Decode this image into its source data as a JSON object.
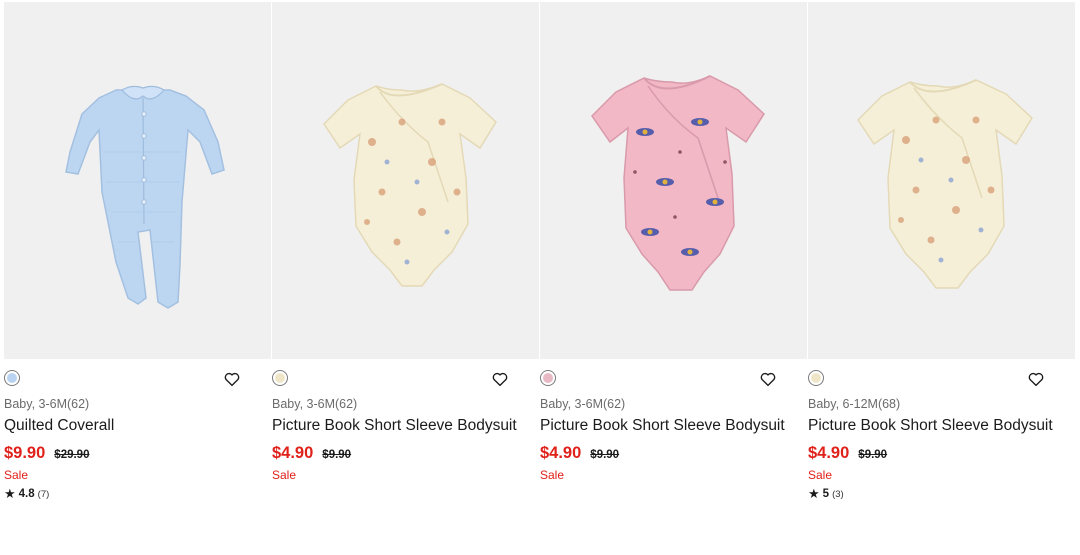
{
  "products": [
    {
      "size": "Baby, 3-6M(62)",
      "name": "Quilted Coverall",
      "price": "$9.90",
      "original_price": "$29.90",
      "sale_label": "Sale",
      "rating": "4.8",
      "review_count": "(7)",
      "color": "#b9d3f0",
      "image_icon": "blue-coverall-image"
    },
    {
      "size": "Baby, 3-6M(62)",
      "name": "Picture Book Short Sleeve Bodysuit",
      "price": "$4.90",
      "original_price": "$9.90",
      "sale_label": "Sale",
      "color": "#efe6c8",
      "image_icon": "cream-bodysuit-image"
    },
    {
      "size": "Baby, 3-6M(62)",
      "name": "Picture Book Short Sleeve Bodysuit",
      "price": "$4.90",
      "original_price": "$9.90",
      "sale_label": "Sale",
      "color": "#e8b9c4",
      "image_icon": "pink-bodysuit-image"
    },
    {
      "size": "Baby, 6-12M(68)",
      "name": "Picture Book Short Sleeve Bodysuit",
      "price": "$4.90",
      "original_price": "$9.90",
      "sale_label": "Sale",
      "rating": "5",
      "review_count": "(3)",
      "color": "#efe6c8",
      "image_icon": "cream-bodysuit-image"
    }
  ],
  "icons": {
    "favorite": "heart-outline-icon",
    "rating": "star-icon"
  },
  "colors": {
    "price_red": "#e0211a",
    "image_bg": "#f0f0f0"
  }
}
